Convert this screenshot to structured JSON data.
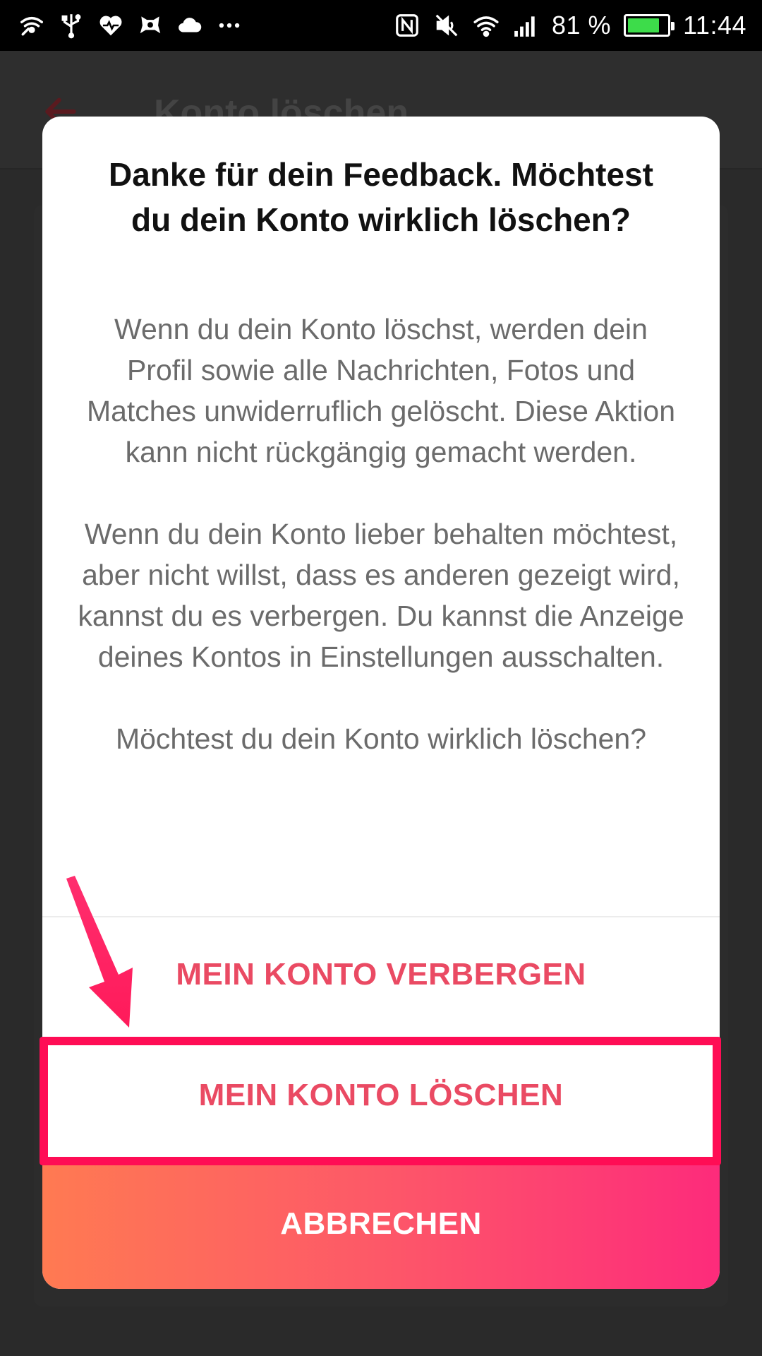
{
  "status_bar": {
    "battery_percent": "81 %",
    "battery_level": 0.81,
    "time": "11:44",
    "left_icons": [
      "wifi-hotspot-icon",
      "usb-icon",
      "health-heart-icon",
      "game-controller-icon",
      "cloud-icon",
      "more-dots-icon"
    ],
    "right_icons": [
      "nfc-icon",
      "mute-icon",
      "wifi-icon",
      "signal-icon",
      "battery-icon"
    ]
  },
  "background_app": {
    "title": "Konto löschen",
    "back_icon": "back-arrow-icon"
  },
  "dialog": {
    "title": "Danke für dein Feedback. Möchtest du dein Konto wirklich löschen?",
    "paragraph_1": "Wenn du dein Konto löschst, werden dein Profil sowie alle Nachrichten, Fotos und Matches unwiderruflich gelöscht. Diese Aktion kann nicht rückgängig gemacht werden.",
    "paragraph_2": "Wenn du dein Konto lieber behalten möchtest, aber nicht willst, dass es anderen gezeigt wird, kannst du es ver­bergen. Du kannst die Anzeige deines Kontos in Einstellungen ausschalten.",
    "paragraph_3": "Möchtest du dein Konto wirklich löschen?",
    "buttons": {
      "hide": "MEIN KONTO VERBERGEN",
      "delete": "MEIN KONTO LÖSCHEN",
      "cancel": "ABBRECHEN"
    }
  },
  "colors": {
    "accent": "#ea4a63",
    "highlight": "#ff0d55",
    "gradient_start": "#ff7a52",
    "gradient_end": "#fd2b7b",
    "battery": "#3ddc4a"
  }
}
